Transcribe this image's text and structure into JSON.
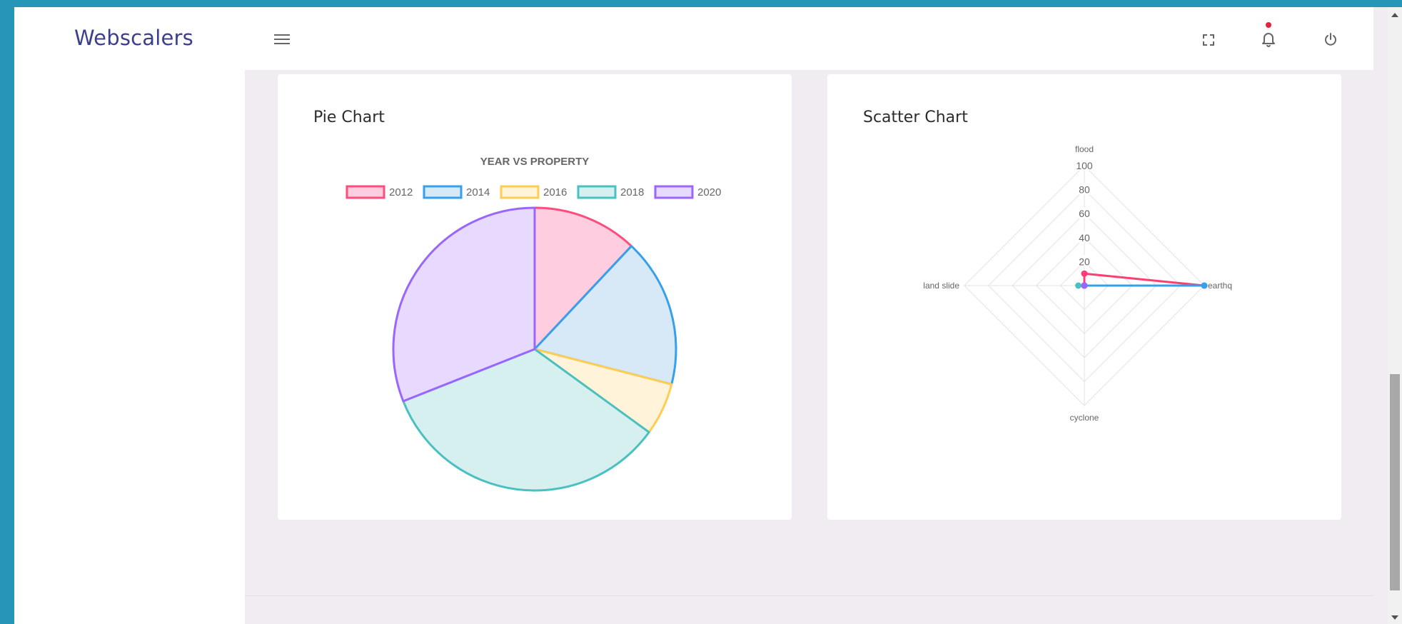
{
  "app": {
    "brand": "Webscalers"
  },
  "topbar": {
    "menu_icon": "hamburger-menu-icon",
    "fullscreen_icon": "fullscreen-icon",
    "notification_icon": "bell-icon",
    "power_icon": "power-icon",
    "notification_dot_color": "#e7203f"
  },
  "cards": {
    "pie": {
      "title": "Pie Chart"
    },
    "radar": {
      "title": "Scatter Chart"
    }
  },
  "chart_data": [
    {
      "type": "pie",
      "title": "YEAR VS PROPERTY",
      "legend_position": "top",
      "categories": [
        "2012",
        "2014",
        "2016",
        "2018",
        "2020"
      ],
      "values": [
        12,
        17,
        6,
        34,
        31
      ],
      "colors": [
        "#ff4d7c",
        "#36a0ea",
        "#ffcd56",
        "#4bc0c0",
        "#9966ff"
      ],
      "fills": [
        "#ffcde0",
        "#d7e9f7",
        "#fff3d9",
        "#d5f0ef",
        "#e8daff"
      ]
    },
    {
      "type": "radar",
      "axes": [
        "flood",
        "earthq",
        "cyclone",
        "land slide"
      ],
      "rlim": [
        0,
        100
      ],
      "ticks": [
        "20",
        "40",
        "60",
        "80",
        "100"
      ],
      "grid": true,
      "series": [
        {
          "color": "#ff3d75",
          "values": [
            10,
            100,
            0,
            0
          ]
        },
        {
          "color": "#36a0ea",
          "values": [
            0,
            100,
            0,
            0
          ]
        },
        {
          "color": "#ffcd56",
          "values": [
            0,
            0,
            0,
            0
          ]
        },
        {
          "color": "#4bc0c0",
          "values": [
            0,
            0,
            0,
            5
          ]
        },
        {
          "color": "#9966ff",
          "values": [
            0,
            0,
            0,
            0
          ]
        }
      ]
    }
  ]
}
